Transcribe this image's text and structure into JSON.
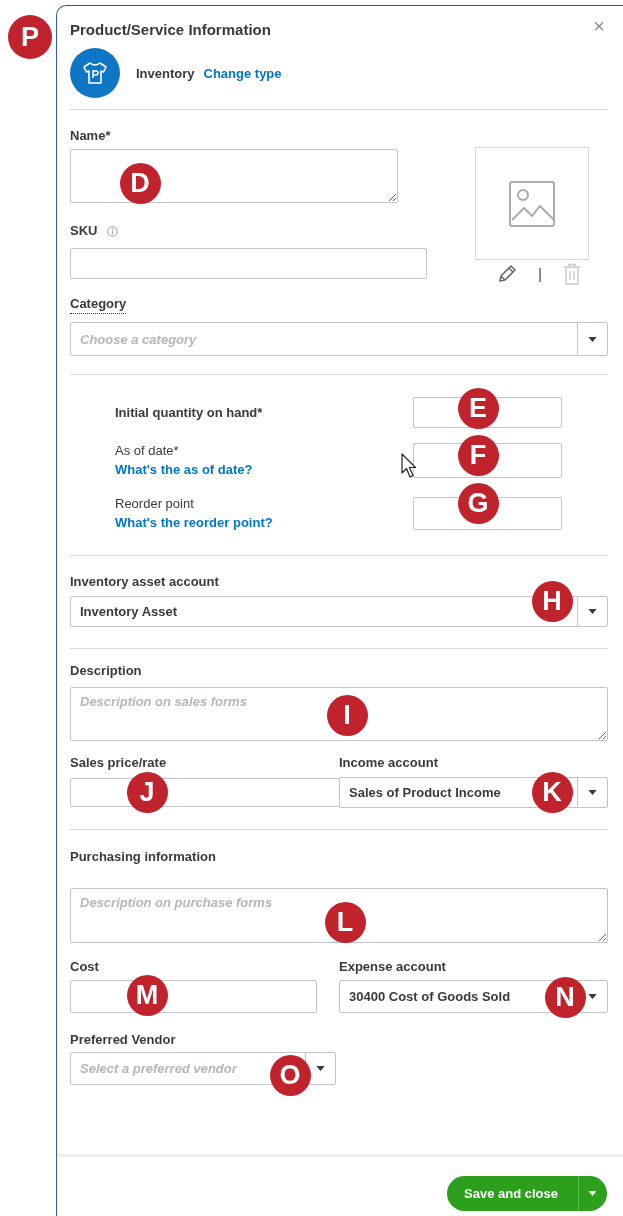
{
  "dialog": {
    "title": "Product/Service Information",
    "close": "×",
    "callout": "P"
  },
  "type_row": {
    "type": "Inventory",
    "link": "Change type"
  },
  "name": {
    "label": "Name*",
    "callout": "D"
  },
  "image_actions": {
    "separator": "|"
  },
  "sku": {
    "label": "SKU"
  },
  "category": {
    "label": "Category",
    "placeholder": "Choose a category"
  },
  "quantities": [
    {
      "label": "Initial quantity on hand*",
      "callout": "E"
    },
    {
      "label": "As of date*",
      "help": "What's the as of date?",
      "callout": "F"
    },
    {
      "label": "Reorder point",
      "help": "What's the reorder point?",
      "callout": "G"
    }
  ],
  "inventory_account": {
    "label": "Inventory asset account",
    "value": "Inventory Asset",
    "callout": "H"
  },
  "description": {
    "label": "Description",
    "placeholder": "Description on sales forms",
    "callout": "I"
  },
  "sales_price": {
    "label": "Sales price/rate",
    "callout": "J"
  },
  "income_account": {
    "label": "Income account",
    "value": "Sales of Product Income",
    "callout": "K"
  },
  "purchasing": {
    "label": "Purchasing information",
    "placeholder": "Description on purchase forms",
    "callout": "L"
  },
  "cost": {
    "label": "Cost",
    "callout": "M"
  },
  "expense_account": {
    "label": "Expense account",
    "value": "30400 Cost of Goods Sold",
    "callout": "N"
  },
  "vendor": {
    "label": "Preferred Vendor",
    "placeholder": "Select a preferred vendor",
    "callout": "O"
  },
  "footer": {
    "button": "Save and close"
  }
}
